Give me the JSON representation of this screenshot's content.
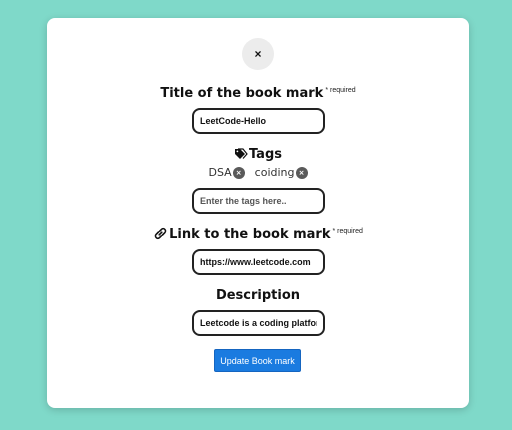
{
  "modal": {
    "close_label": "×",
    "title_label": "Title of the book mark",
    "title_required": "* required",
    "title_value": "LeetCode-Hello",
    "tags_label": "Tags",
    "tags": [
      {
        "label": "DSA",
        "remove": "×"
      },
      {
        "label": "coiding",
        "remove": "×"
      }
    ],
    "tags_placeholder": "Enter the tags here..",
    "link_label": "Link to the book mark",
    "link_required": "* required",
    "link_value": "https://www.leetcode.com",
    "description_label": "Description",
    "description_value": "Leetcode is a coding platform",
    "update_label": "Update Book mark"
  },
  "colors": {
    "background": "#7fd9c9",
    "accent": "#1a7be0"
  }
}
